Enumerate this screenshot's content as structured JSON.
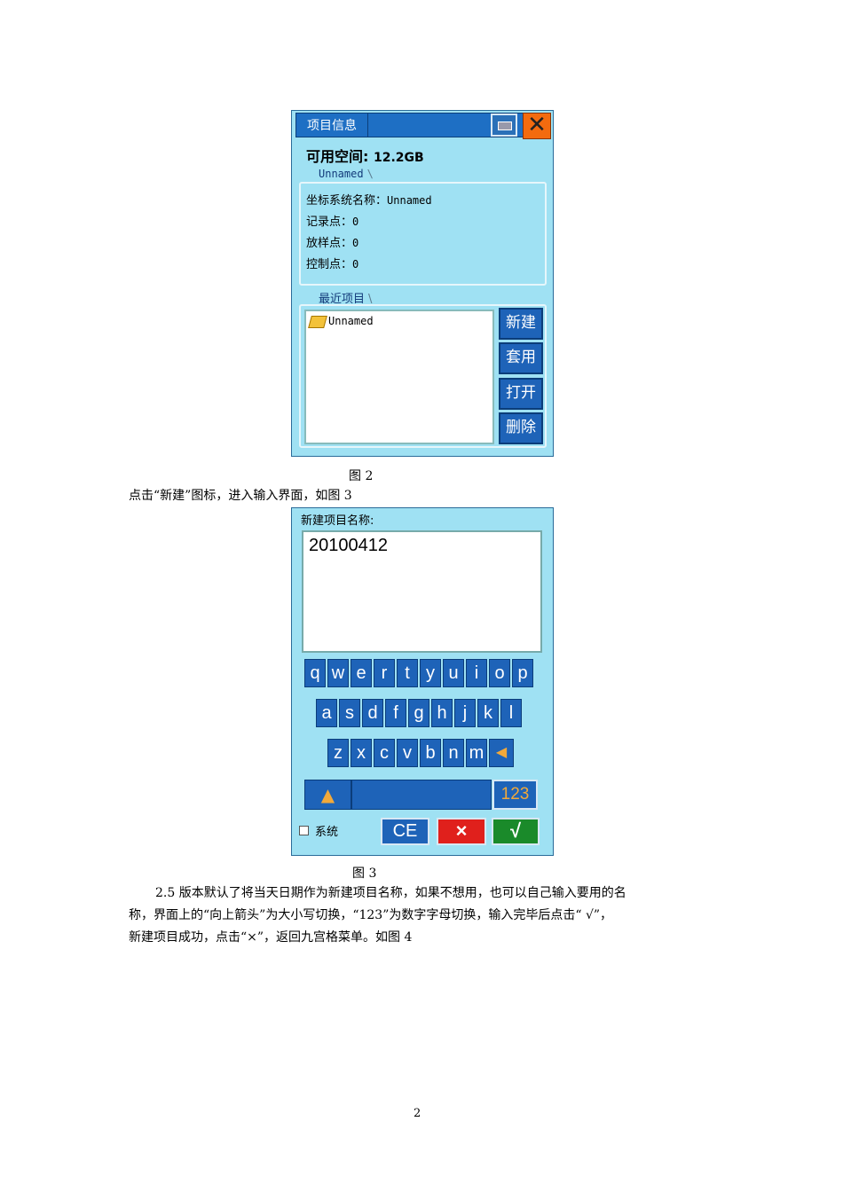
{
  "screen1": {
    "title": "项目信息",
    "space_label": "可用空间:",
    "space_value": "12.2GB",
    "current_tab": "Unnamed",
    "coord_label": "坐标系统名称：",
    "coord_value": "Unnamed",
    "record_label": "记录点：",
    "record_value": "0",
    "stake_label": "放样点：",
    "stake_value": "0",
    "control_label": "控制点：",
    "control_value": "0",
    "recent_tab": "最近项目",
    "recent_items": [
      "Unnamed"
    ],
    "buttons": {
      "new": "新建",
      "apply": "套用",
      "open": "打开",
      "delete": "删除"
    },
    "close_glyph": "✕"
  },
  "caption2": "图 2",
  "instruction1": "点击“新建”图标，进入输入界面，如图 3",
  "screen2": {
    "prompt": "新建项目名称:",
    "input_value": "20100412",
    "row1": [
      "q",
      "w",
      "e",
      "r",
      "t",
      "y",
      "u",
      "i",
      "o",
      "p"
    ],
    "row2": [
      "a",
      "s",
      "d",
      "f",
      "g",
      "h",
      "j",
      "k",
      "l"
    ],
    "row3": [
      "z",
      "x",
      "c",
      "v",
      "b",
      "n",
      "m"
    ],
    "backspace_glyph": "◀",
    "shift_glyph": "▲",
    "numeric_label": "123",
    "system_label": "系统",
    "ce_label": "CE",
    "cancel_label": "×",
    "ok_label": "√"
  },
  "caption3": "图 3",
  "paragraph": {
    "line1": "2.5 版本默认了将当天日期作为新建项目名称，如果不想用，也可以自己输入要用的名",
    "line2": "称，界面上的“向上箭头”为大小写切换，“123”为数字字母切换，输入完毕后点击“ √”，",
    "line3": "新建项目成功，点击“×”，返回九宫格菜单。如图 4"
  },
  "page_number": "2",
  "colors": {
    "screen_bg": "#9fe1f3",
    "button_blue": "#1e63b8",
    "close_orange": "#f36b0f",
    "cancel_red": "#e0201c",
    "ok_green": "#1a8a2a"
  }
}
